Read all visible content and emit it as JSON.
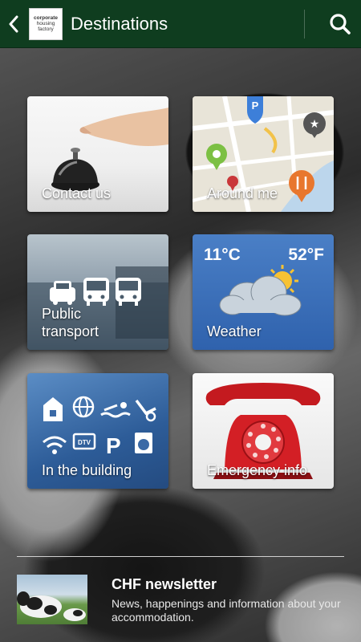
{
  "header": {
    "title": "Destinations",
    "logo_line1": "corporate",
    "logo_line2": "housing",
    "logo_line3": "factory",
    "back_icon": "chevron-left-icon",
    "search_icon": "search-icon",
    "color": "#0f3d1f"
  },
  "tiles": [
    {
      "label": "Contact us"
    },
    {
      "label": "Around me"
    },
    {
      "label": "Public transport"
    },
    {
      "label": "Weather"
    },
    {
      "label": "In the building"
    },
    {
      "label": "Emergency info"
    }
  ],
  "weather": {
    "temp_c": "11°C",
    "temp_f": "52°F"
  },
  "newsletter": {
    "title": "CHF newsletter",
    "description": "News, happenings and information about your accommodation."
  }
}
